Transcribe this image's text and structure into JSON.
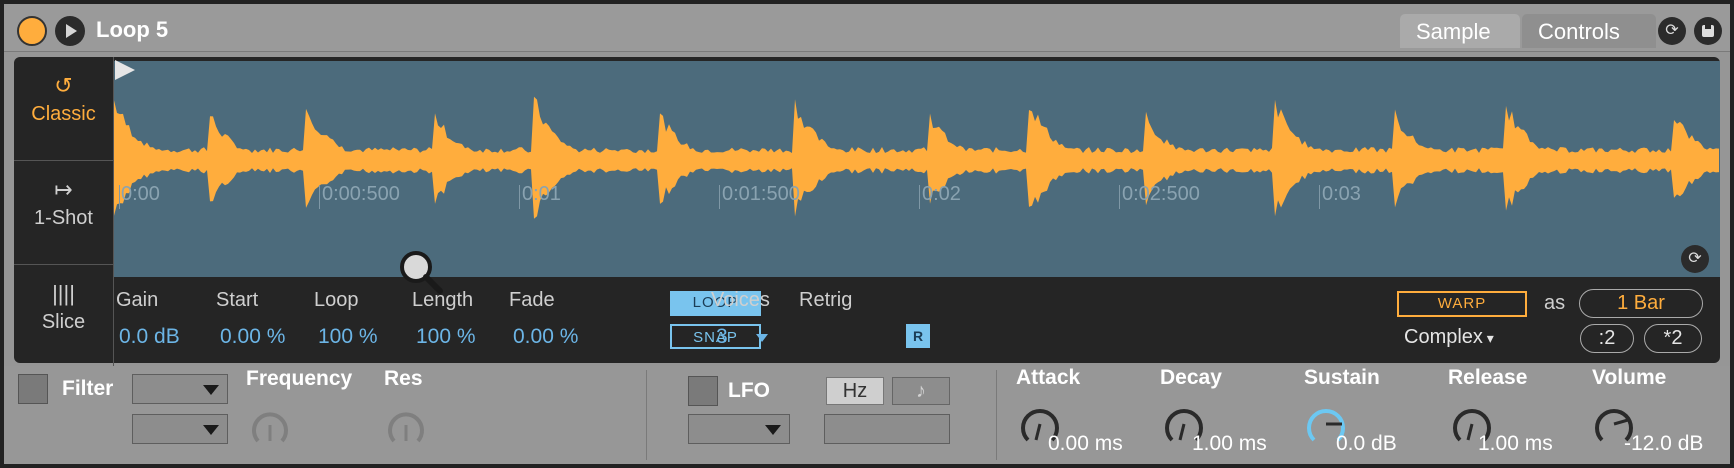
{
  "header": {
    "title": "Loop 5",
    "tabs": [
      {
        "label": "Sample"
      },
      {
        "label": "Controls"
      }
    ]
  },
  "modes": [
    {
      "label": "Classic",
      "icon": "loop-arrow-icon",
      "active": true
    },
    {
      "label": "1-Shot",
      "icon": "one-shot-icon"
    },
    {
      "label": "Slice",
      "icon": "slice-icon"
    }
  ],
  "waveform": {
    "time_ticks": [
      "0:00",
      "0:00:500",
      "0:01",
      "0:01:500",
      "0:02",
      "0:02:500",
      "0:03"
    ],
    "color": "#ffad3d",
    "background": "#4c6b7c"
  },
  "params": {
    "gain": {
      "label": "Gain",
      "value": "0.0 dB"
    },
    "start": {
      "label": "Start",
      "value": "0.00 %"
    },
    "loop": {
      "label": "Loop",
      "value": "100 %"
    },
    "length": {
      "label": "Length",
      "value": "100 %"
    },
    "fade": {
      "label": "Fade",
      "value": "0.00 %"
    },
    "loop_toggle": "LOOP",
    "snap_toggle": "SNAP",
    "voices": {
      "label": "Voices",
      "value": "3"
    },
    "retrig": {
      "label": "Retrig",
      "button": "R"
    }
  },
  "warp": {
    "label": "WARP",
    "as": "as",
    "length": "1 Bar",
    "mode": "Complex",
    "half": ":2",
    "double": "*2"
  },
  "filter": {
    "label": "Filter",
    "frequency_label": "Frequency",
    "res_label": "Res"
  },
  "lfo": {
    "label": "LFO",
    "hz": "Hz",
    "note": "♪"
  },
  "envelope": {
    "attack": {
      "label": "Attack",
      "value": "0.00 ms"
    },
    "decay": {
      "label": "Decay",
      "value": "1.00 ms"
    },
    "sustain": {
      "label": "Sustain",
      "value": "0.0 dB"
    },
    "release": {
      "label": "Release",
      "value": "1.00 ms"
    },
    "volume": {
      "label": "Volume",
      "value": "-12.0 dB"
    }
  },
  "colors": {
    "accent": "#ffad3d",
    "value_blue": "#6cb5e6",
    "toggle_blue": "#79c4ee"
  }
}
